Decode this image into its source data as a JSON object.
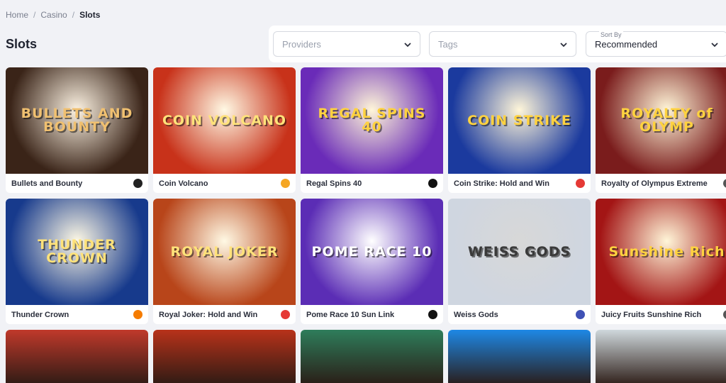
{
  "breadcrumb": {
    "home": "Home",
    "casino": "Casino",
    "current": "Slots",
    "sep": "/"
  },
  "page_title": "Slots",
  "filters": {
    "providers_placeholder": "Providers",
    "tags_placeholder": "Tags",
    "sort_label": "Sort By",
    "sort_value": "Recommended"
  },
  "games": [
    {
      "name": "Bullets and Bounty",
      "art": "BULLETS AND BOUNTY",
      "provider_icon": "provider-logo-icon",
      "bg": "#3a2418",
      "fg": "#f0c070",
      "badge": "#222"
    },
    {
      "name": "Coin Volcano",
      "art": "COIN VOLCANO",
      "provider_icon": "provider-logo-icon",
      "bg": "#c8321a",
      "fg": "#ffe27a",
      "badge": "#f5a623"
    },
    {
      "name": "Regal Spins 40",
      "art": "REGAL SPINS 40",
      "provider_icon": "provider-logo-icon",
      "bg": "#6a2bb8",
      "fg": "#ffd23f",
      "badge": "#111"
    },
    {
      "name": "Coin Strike: Hold and Win",
      "art": "COIN STRIKE",
      "provider_icon": "provider-logo-icon",
      "bg": "#1b3a9e",
      "fg": "#ffd23f",
      "badge": "#e53935"
    },
    {
      "name": "Royalty of Olympus Extreme",
      "art": "ROYALTY of OLYMP",
      "provider_icon": "provider-logo-icon",
      "bg": "#7a1c1c",
      "fg": "#ffd23f",
      "badge": "#555"
    },
    {
      "name": "Thunder Crown",
      "art": "THUNDER CROWN",
      "provider_icon": "provider-logo-icon",
      "bg": "#173a8c",
      "fg": "#ffe27a",
      "badge": "#f57c00"
    },
    {
      "name": "Royal Joker: Hold and Win",
      "art": "ROYAL JOKER",
      "provider_icon": "provider-logo-icon",
      "bg": "#b8451a",
      "fg": "#ffe27a",
      "badge": "#e53935"
    },
    {
      "name": "Pome Race 10 Sun Link",
      "art": "POME RACE 10",
      "provider_icon": "provider-logo-icon",
      "bg": "#5b2db5",
      "fg": "#ffffff",
      "badge": "#111"
    },
    {
      "name": "Weiss Gods",
      "art": "WEISS GODS",
      "provider_icon": "provider-logo-icon",
      "bg": "#cfd6e0",
      "fg": "#3a3a3a",
      "badge": "#3f51b5"
    },
    {
      "name": "Juicy Fruits Sunshine Rich",
      "art": "Sunshine Rich",
      "provider_icon": "provider-logo-icon",
      "bg": "#a31515",
      "fg": "#ffd23f",
      "badge": "#555"
    }
  ],
  "row3": [
    {
      "bg": "#c0392b"
    },
    {
      "bg": "#b8321a"
    },
    {
      "bg": "#2e7d5b"
    },
    {
      "bg": "#1e88e5"
    },
    {
      "bg": "#cfd8dc"
    }
  ]
}
